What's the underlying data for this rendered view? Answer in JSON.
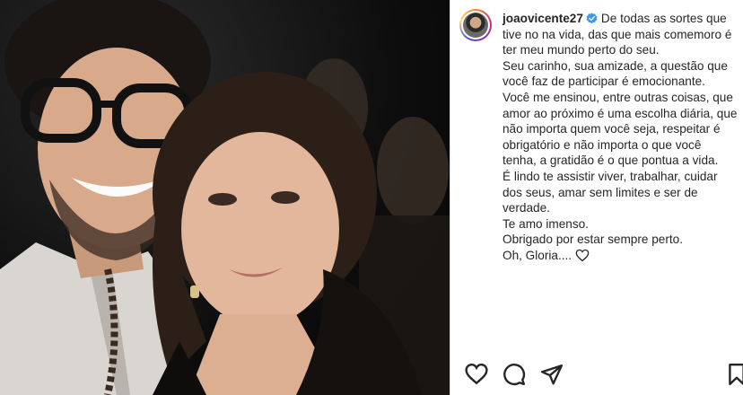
{
  "post": {
    "username": "joaovicente27",
    "verified": true,
    "caption_lines": [
      "De todas as sortes que tive no na vida, das que mais comemoro é ter meu mundo perto do seu.",
      "Seu carinho, sua amizade, a questão que você faz de participar é emocionante.",
      "Você me ensinou, entre outras coisas, que amor ao próximo é uma escolha diária, que não importa quem você seja, respeitar é obrigatório e não importa o que você tenha, a gratidão é o que pontua a vida.",
      "É lindo te assistir viver, trabalhar, cuidar dos seus, amar sem limites e ser de verdade.",
      "Te amo imenso.",
      "Obrigado por estar sempre perto.",
      "Oh, Gloria...."
    ]
  },
  "icons": {
    "verified": "verified-badge-icon",
    "caption_end": "heart-icon",
    "like": "heart-icon",
    "comment": "comment-icon",
    "share": "paper-plane-icon",
    "save": "bookmark-icon"
  },
  "colors": {
    "verified_blue": "#3897f0",
    "text": "#262626",
    "divider": "#dbdbdb"
  }
}
